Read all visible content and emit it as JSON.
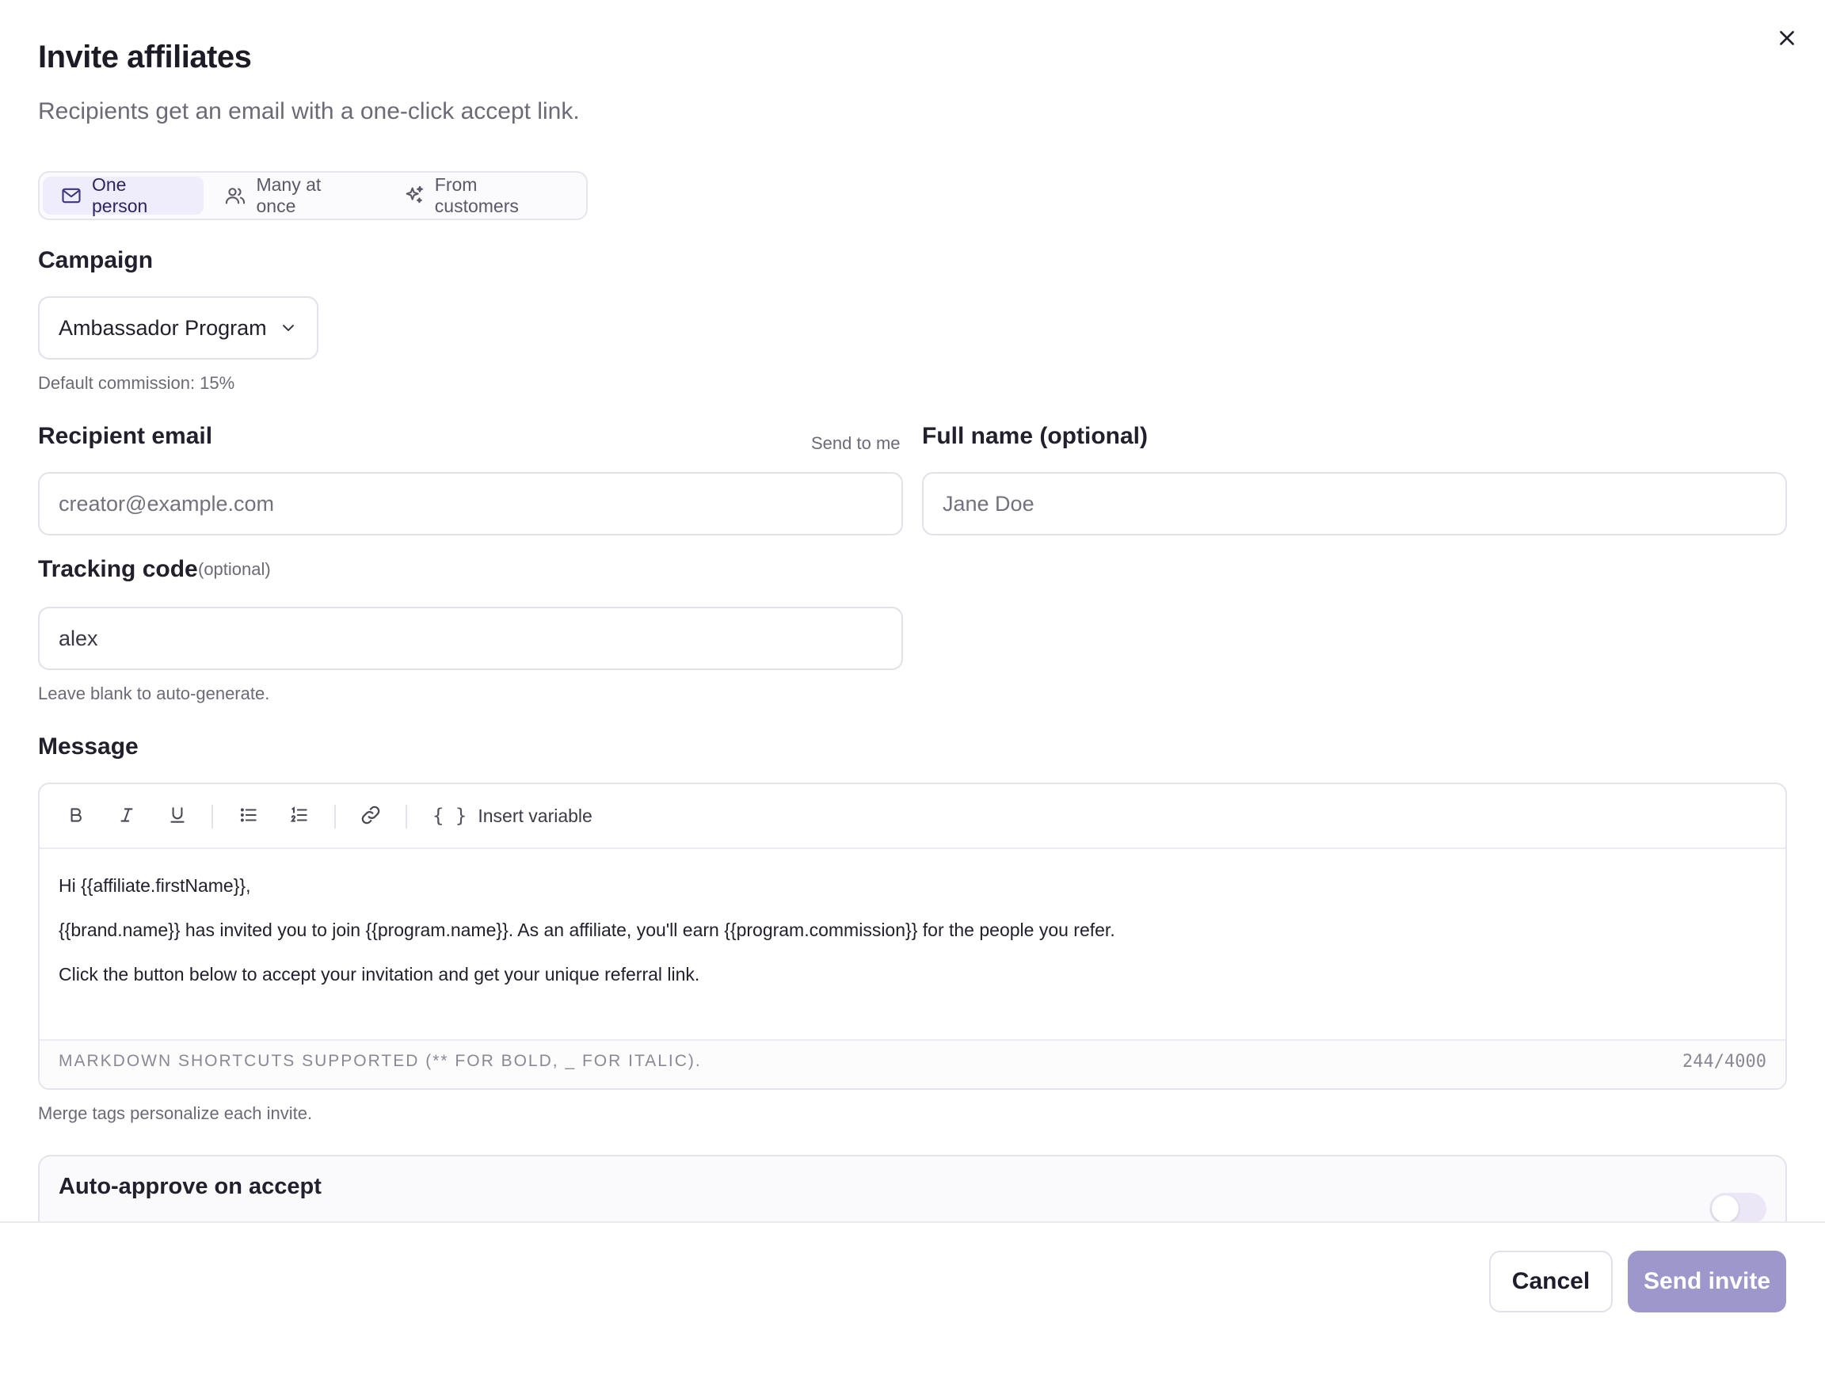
{
  "modal": {
    "title": "Invite affiliates",
    "subtitle": "Recipients get an email with a one-click accept link.",
    "close_icon": "close-icon"
  },
  "tabs": [
    {
      "label": "One person",
      "icon": "mail-icon",
      "active": true
    },
    {
      "label": "Many at once",
      "icon": "users-icon",
      "active": false
    },
    {
      "label": "From customers",
      "icon": "sparkles-icon",
      "active": false
    }
  ],
  "campaign": {
    "label": "Campaign",
    "selected": "Ambassador Program",
    "hint": "Default commission: 15%"
  },
  "recipient": {
    "label": "Recipient email",
    "send_to_me": "Send to me",
    "placeholder": "creator@example.com",
    "value": ""
  },
  "full_name": {
    "label": "Full name (optional)",
    "placeholder": "Jane Doe",
    "value": ""
  },
  "tracking": {
    "label": "Tracking code",
    "optional": "(optional)",
    "value": "alex",
    "hint": "Leave blank to auto-generate."
  },
  "message": {
    "label": "Message",
    "toolbar": {
      "tools": [
        "bold-icon",
        "italic-icon",
        "underline-icon",
        "bullet-list-icon",
        "numbered-list-icon",
        "link-icon"
      ],
      "insert_variable": "Insert variable"
    },
    "lines": [
      "Hi {{affiliate.firstName}},",
      "{{brand.name}} has invited you to join {{program.name}}. As an affiliate, you'll earn {{program.commission}} for the people you refer.",
      "Click the button below to accept your invitation and get your unique referral link."
    ],
    "markdown_hint": "Markdown shortcuts supported (** for bold, _ for italic).",
    "counter": "244/4000",
    "hint": "Merge tags personalize each invite."
  },
  "auto_approve": {
    "title": "Auto-approve on accept",
    "enabled": false
  },
  "footer": {
    "cancel": "Cancel",
    "send": "Send invite"
  },
  "colors": {
    "accent": "#9e97cc",
    "active_tab_bg": "#efecfb",
    "active_tab_text": "#2d2560",
    "border": "#e3e0ea"
  }
}
